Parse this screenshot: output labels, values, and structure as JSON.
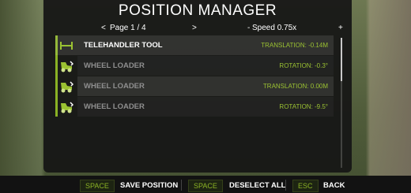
{
  "title": "POSITION MANAGER",
  "nav": {
    "prev": "<",
    "page": "Page 1 / 4",
    "next": ">",
    "speed_minus": "-",
    "speed": "Speed 0.75x",
    "speed_plus": "+"
  },
  "items": [
    {
      "name": "TELEHANDLER TOOL",
      "info": "TRANSLATION: -0.14M",
      "icon": "telehandler-tool-icon",
      "selected": true
    },
    {
      "name": "WHEEL LOADER",
      "info": "ROTATION: -0.3°",
      "icon": "wheel-loader-icon",
      "selected": false
    },
    {
      "name": "WHEEL LOADER",
      "info": "TRANSLATION: 0.00M",
      "icon": "wheel-loader-icon",
      "selected": false
    },
    {
      "name": "WHEEL LOADER",
      "info": "ROTATION: -9.5°",
      "icon": "wheel-loader-icon",
      "selected": false
    }
  ],
  "footer": {
    "save_key": "SPACE",
    "save_label": "SAVE POSITION",
    "deselect_key": "SPACE",
    "deselect_label": "DESELECT ALL",
    "back_key": "ESC",
    "back_label": "BACK"
  },
  "colors": {
    "accent": "#8ab224",
    "value": "#9bc232",
    "panel": "#161616"
  }
}
